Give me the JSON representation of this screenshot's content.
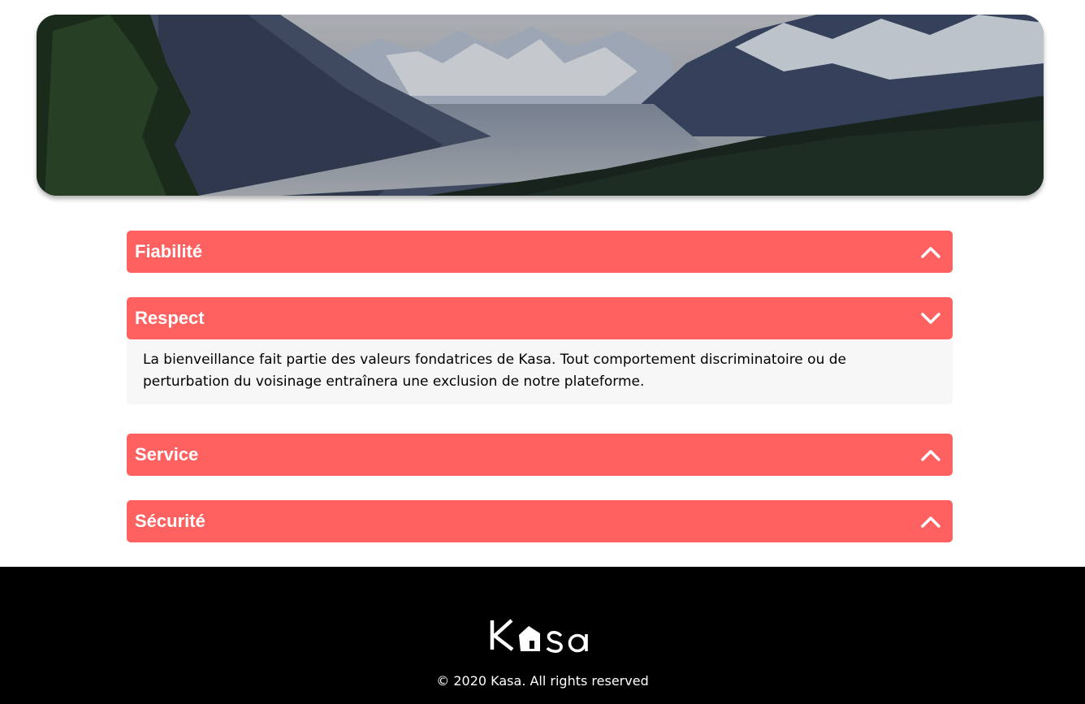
{
  "banner": {
    "image_name": "mountain-valley-landscape"
  },
  "sections": [
    {
      "title": "Fiabilité",
      "state": "closed",
      "icon": "chevron-up-icon"
    },
    {
      "title": "Respect",
      "state": "open",
      "icon": "chevron-down-icon",
      "content": "La bienveillance fait partie des valeurs fondatrices de Kasa. Tout comportement discriminatoire ou de perturbation du voisinage entraînera une exclusion de notre plateforme."
    },
    {
      "title": "Service",
      "state": "closed",
      "icon": "chevron-up-icon"
    },
    {
      "title": "Sécurité",
      "state": "closed",
      "icon": "chevron-up-icon"
    }
  ],
  "footer": {
    "logo": "Kasa",
    "copyright": "© 2020 Kasa. All rights reserved"
  },
  "colors": {
    "accent": "#ff6060",
    "panel": "#f7f7f7",
    "footer_bg": "#000000"
  }
}
